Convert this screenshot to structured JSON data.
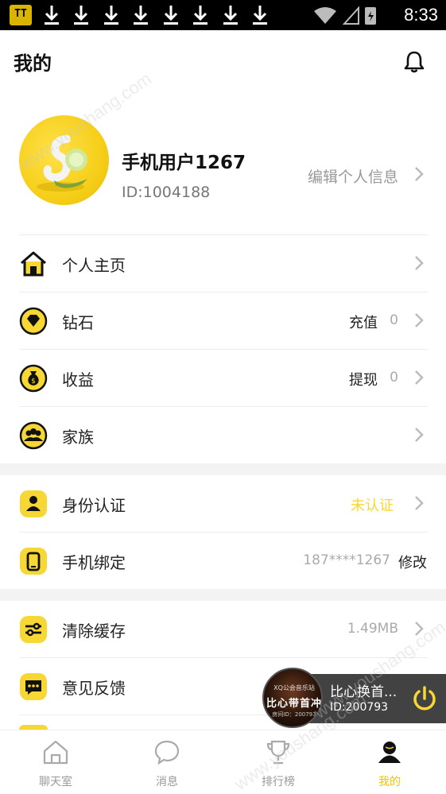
{
  "status_bar": {
    "time": "8:33",
    "app_badge": "TT",
    "download_icons": [
      "download-icon",
      "download-icon",
      "download-icon",
      "download-icon",
      "download-icon",
      "download-icon",
      "download-icon",
      "download-icon"
    ]
  },
  "header": {
    "title": "我的"
  },
  "profile": {
    "username": "手机用户1267",
    "user_id": "ID:1004188",
    "edit_label": "编辑个人信息"
  },
  "menu_group1": [
    {
      "icon": "home-icon",
      "label": "个人主页"
    },
    {
      "icon": "diamond-icon",
      "label": "钻石",
      "action": "充值",
      "value": "0"
    },
    {
      "icon": "money-bag-icon",
      "label": "收益",
      "action": "提现",
      "value": "0"
    },
    {
      "icon": "family-icon",
      "label": "家族"
    }
  ],
  "menu_group2": [
    {
      "icon": "person-icon",
      "label": "身份认证",
      "status": "未认证"
    },
    {
      "icon": "phone-icon",
      "label": "手机绑定",
      "value": "187****1267",
      "action": "修改"
    }
  ],
  "menu_group3": [
    {
      "icon": "sliders-icon",
      "label": "清除缓存",
      "value": "1.49MB"
    },
    {
      "icon": "chat-icon",
      "label": "意见反馈"
    }
  ],
  "room_pill": {
    "name": "比心换首...",
    "room_id": "ID:200793",
    "thumb_line1": "XQ公会音乐站",
    "thumb_line2": "比心带首冲",
    "thumb_line3": "房间ID：200793"
  },
  "bottom_nav": [
    {
      "icon": "chatroom-icon",
      "label": "聊天室"
    },
    {
      "icon": "message-icon",
      "label": "消息"
    },
    {
      "icon": "trophy-icon",
      "label": "排行榜"
    },
    {
      "icon": "profile-icon",
      "label": "我的",
      "active": true
    }
  ],
  "watermarks": [
    "www.youshang.com",
    "www.youshang.com",
    "www.youshang.com"
  ],
  "colors": {
    "accent": "#f7d733",
    "active_nav": "#f0c500",
    "muted": "#999999"
  }
}
